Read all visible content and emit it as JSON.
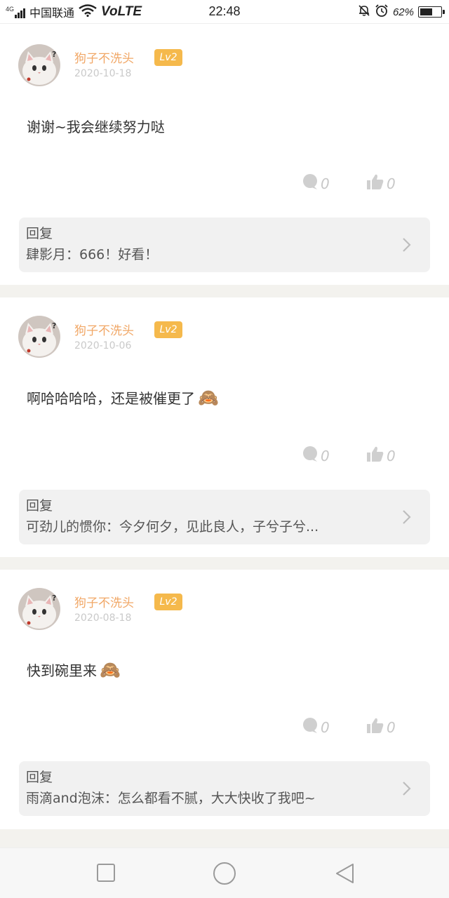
{
  "status_bar": {
    "network": "4G",
    "carrier": "中国联通",
    "volte": "VoLTE",
    "time": "22:48",
    "battery": "62%",
    "battery_level": 0.62
  },
  "comments": [
    {
      "username": "狗子不洗头",
      "level": "Lv2",
      "date": "2020-10-18",
      "content": "谢谢~我会继续努力哒",
      "emoji": "",
      "comment_count": "0",
      "like_count": "0",
      "reply_label": "回复",
      "reply_text": "肆影月：666！好看！"
    },
    {
      "username": "狗子不洗头",
      "level": "Lv2",
      "date": "2020-10-06",
      "content": "啊哈哈哈哈，还是被催更了",
      "emoji": "🙈",
      "comment_count": "0",
      "like_count": "0",
      "reply_label": "回复",
      "reply_text": "可劲儿的惯你：今夕何夕，见此良人，子兮子兮..."
    },
    {
      "username": "狗子不洗头",
      "level": "Lv2",
      "date": "2020-08-18",
      "content": "快到碗里来",
      "emoji": "🙈",
      "comment_count": "0",
      "like_count": "0",
      "reply_label": "回复",
      "reply_text": "雨滴and泡沫：怎么都看不腻，大大快收了我吧~"
    }
  ],
  "colors": {
    "username": "#f1a766",
    "badge": "#f5b94c",
    "reply_bg": "#f1f1f1",
    "separator": "#f3f2ee"
  },
  "icons": {
    "comment": "speech-bubble-icon",
    "like": "thumbs-up-icon",
    "more": "chevron-right-icon",
    "nav_recent": "square-icon",
    "nav_home": "circle-icon",
    "nav_back": "triangle-back-icon"
  }
}
